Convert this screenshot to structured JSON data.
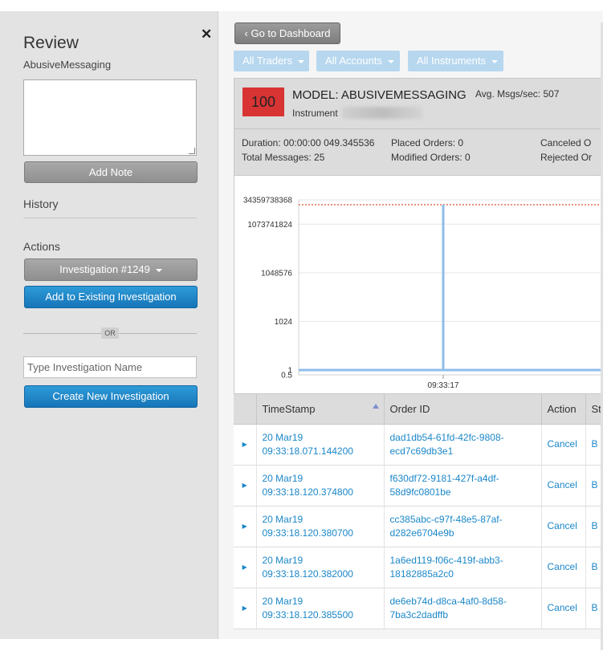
{
  "review": {
    "title": "Review",
    "subtitle": "AbusiveMessaging",
    "note_value": "",
    "add_note_label": "Add Note",
    "history_label": "History",
    "actions_label": "Actions",
    "investigation_select": "Investigation #1249",
    "add_existing_label": "Add to Existing Investigation",
    "or_label": "OR",
    "investigation_name_placeholder": "Type Investigation Name",
    "create_new_label": "Create New Investigation"
  },
  "toolbar": {
    "dashboard_label": "Go to Dashboard",
    "filters": [
      "All Traders",
      "All Accounts",
      "All Instruments"
    ]
  },
  "model": {
    "score": "100",
    "title": "MODEL: ABUSIVEMESSAGING",
    "avg_msgs": "Avg. Msgs/sec: 507",
    "instrument_label": "Instrument",
    "duration": "Duration: 00:00:00 049.345536",
    "total_messages": "Total Messages: 25",
    "placed_orders": "Placed Orders: 0",
    "modified_orders": "Modified Orders: 0",
    "canceled_orders": "Canceled O",
    "rejected_orders": "Rejected Or"
  },
  "chart_data": {
    "type": "line",
    "title": "",
    "xlabel": "",
    "ylabel": "",
    "y_scale": "log",
    "y_ticks": [
      "0.5",
      "1",
      "1024",
      "1048576",
      "1073741824",
      "34359738368"
    ],
    "x_ticks": [
      "09:33:17"
    ],
    "threshold": 34359738368,
    "series": [
      {
        "values": [
          1,
          34359738368,
          1
        ]
      }
    ],
    "colors": {
      "line": "#8fbdea",
      "threshold": "#e05030",
      "grid": "#e6e6e6"
    }
  },
  "table": {
    "columns": [
      "TimeStamp",
      "Order ID",
      "Action",
      "St"
    ],
    "rows": [
      {
        "date": "20 Mar19",
        "time": "09:33:18.071.144200",
        "id1": "dad1db54-61fd-42fc-9808-",
        "id2": "ecd7c69db3e1",
        "action": "Cancel",
        "st": "B"
      },
      {
        "date": "20 Mar19",
        "time": "09:33:18.120.374800",
        "id1": "f630df72-9181-427f-a4df-",
        "id2": "58d9fc0801be",
        "action": "Cancel",
        "st": "B"
      },
      {
        "date": "20 Mar19",
        "time": "09:33:18.120.380700",
        "id1": "cc385abc-c97f-48e5-87af-",
        "id2": "d282e6704e9b",
        "action": "Cancel",
        "st": "B"
      },
      {
        "date": "20 Mar19",
        "time": "09:33:18.120.382000",
        "id1": "1a6ed119-f06c-419f-abb3-",
        "id2": "18182885a2c0",
        "action": "Cancel",
        "st": "B"
      },
      {
        "date": "20 Mar19",
        "time": "09:33:18.120.385500",
        "id1": "de6eb74d-d8ca-4af0-8d58-",
        "id2": "7ba3c2dadffb",
        "action": "Cancel",
        "st": "B"
      }
    ]
  }
}
